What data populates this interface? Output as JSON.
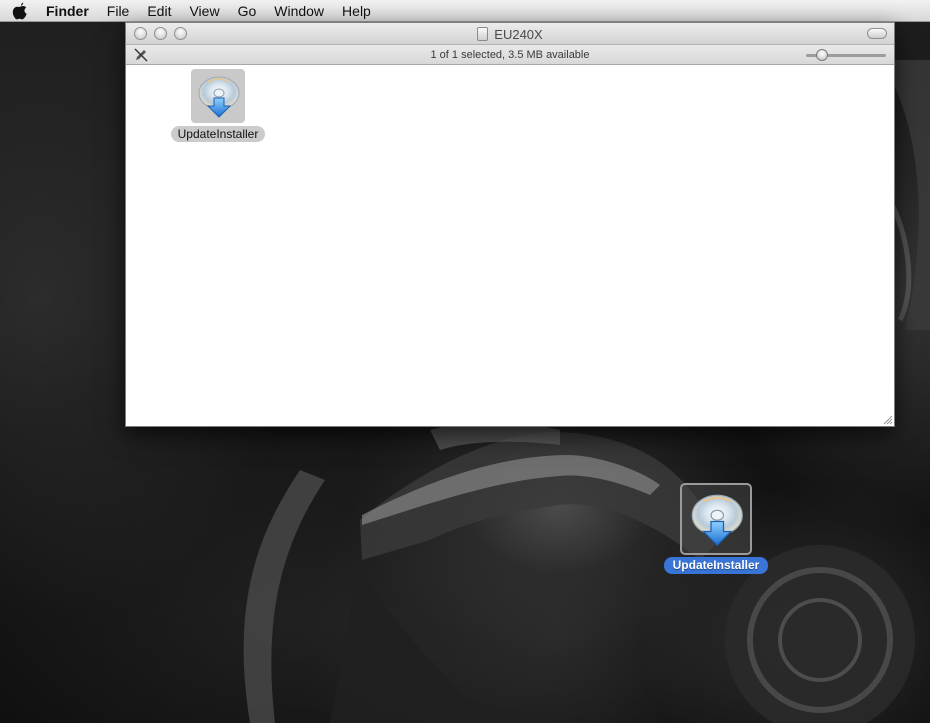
{
  "menubar": {
    "app_name": "Finder",
    "items": [
      "File",
      "Edit",
      "View",
      "Go",
      "Window",
      "Help"
    ]
  },
  "window": {
    "title": "EU240X",
    "status": "1 of 1 selected, 3.5 MB available",
    "file": {
      "label": "UpdateInstaller",
      "icon": "installer-disc-icon"
    }
  },
  "desktop": {
    "file": {
      "label": "UpdateInstaller",
      "icon": "installer-disc-icon",
      "selected": true
    }
  },
  "colors": {
    "selection": "#3875d7",
    "menubar": "#e6e6e6"
  }
}
